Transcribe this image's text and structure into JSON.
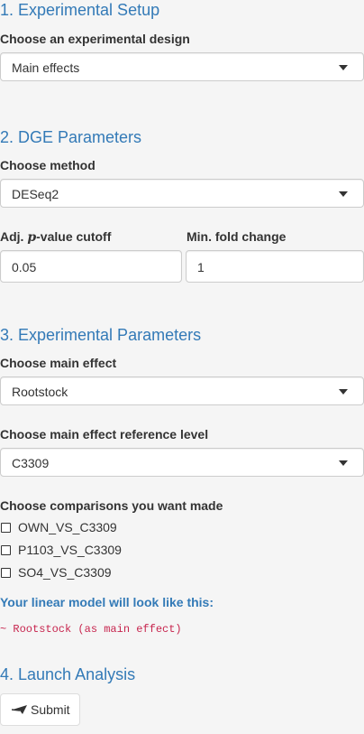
{
  "sections": {
    "setup": {
      "title": "1. Experimental Setup",
      "design_label": "Choose an experimental design",
      "design_value": "Main effects"
    },
    "dge": {
      "title": "2. DGE Parameters",
      "method_label": "Choose method",
      "method_value": "DESeq2",
      "pvalue_label_prefix": "Adj. ",
      "pvalue_label_p": "p",
      "pvalue_label_suffix": "-value cutoff",
      "pvalue_value": "0.05",
      "fold_label": "Min. fold change",
      "fold_value": "1"
    },
    "experimental": {
      "title": "3. Experimental Parameters",
      "main_effect_label": "Choose main effect",
      "main_effect_value": "Rootstock",
      "reference_label": "Choose main effect reference level",
      "reference_value": "C3309",
      "comparisons_label": "Choose comparisons you want made",
      "comparisons": [
        "OWN_VS_C3309",
        "P1103_VS_C3309",
        "SO4_VS_C3309"
      ],
      "model_title": "Your linear model will look like this:",
      "model_formula": "~ Rootstock (as main effect)"
    },
    "launch": {
      "title": "4. Launch Analysis",
      "submit_label": "Submit",
      "submit_icon": "paper-plane-icon"
    }
  },
  "colors": {
    "accent": "#337ab7",
    "formula": "#c7254e",
    "background": "#f5f5f5"
  }
}
